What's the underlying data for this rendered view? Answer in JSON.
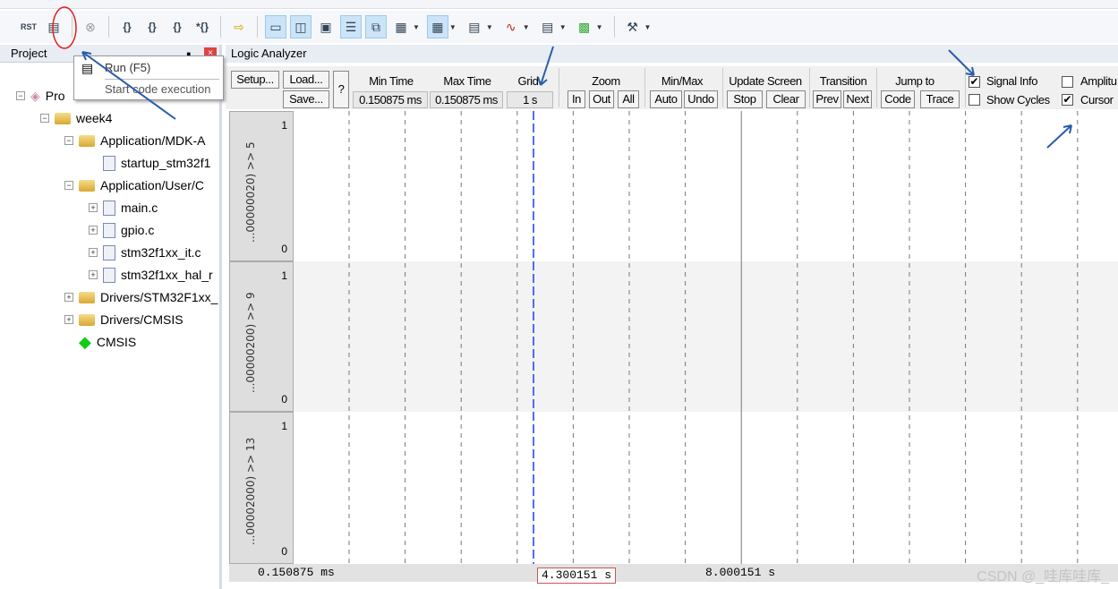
{
  "toolbar": {
    "icons": [
      "reset-icon",
      "run-icon",
      "stop-icon",
      "step-into-icon",
      "step-over-icon",
      "step-out-icon",
      "run-to-cursor-icon",
      "show-next-statement-icon",
      "command-window-icon",
      "disassembly-window-icon",
      "symbols-window-icon",
      "registers-window-icon",
      "call-stack-icon",
      "watch-windows-icon",
      "memory-windows-icon",
      "serial-windows-icon",
      "analysis-windows-icon",
      "trace-windows-icon",
      "system-viewer-icon",
      "toolbox-icon"
    ],
    "rst_label": "RST"
  },
  "project": {
    "title": "Project",
    "tree": [
      {
        "label": "Pro",
        "level": 0,
        "exp": "−",
        "icon": "project"
      },
      {
        "label": "week4",
        "level": 1,
        "exp": "−",
        "icon": "folder"
      },
      {
        "label": "Application/MDK-A",
        "level": 2,
        "exp": "−",
        "icon": "folder"
      },
      {
        "label": "startup_stm32f1",
        "level": 3,
        "exp": "",
        "icon": "file"
      },
      {
        "label": "Application/User/C",
        "level": 2,
        "exp": "−",
        "icon": "folder"
      },
      {
        "label": "main.c",
        "level": 3,
        "exp": "+",
        "icon": "file"
      },
      {
        "label": "gpio.c",
        "level": 3,
        "exp": "+",
        "icon": "file"
      },
      {
        "label": "stm32f1xx_it.c",
        "level": 3,
        "exp": "+",
        "icon": "file"
      },
      {
        "label": "stm32f1xx_hal_r",
        "level": 3,
        "exp": "+",
        "icon": "file"
      },
      {
        "label": "Drivers/STM32F1xx_",
        "level": 2,
        "exp": "+",
        "icon": "folder"
      },
      {
        "label": "Drivers/CMSIS",
        "level": 2,
        "exp": "+",
        "icon": "folder"
      },
      {
        "label": "CMSIS",
        "level": 2,
        "exp": "",
        "icon": "cmsis"
      }
    ]
  },
  "tooltip": {
    "title": "Run (F5)",
    "desc": "Start code execution"
  },
  "la": {
    "title": "Logic Analyzer",
    "setup": "Setup...",
    "load": "Load...",
    "save": "Save...",
    "help": "?",
    "min_time_label": "Min Time",
    "min_time": "0.150875 ms",
    "max_time_label": "Max Time",
    "max_time": "0.150875 ms",
    "grid_label": "Grid",
    "grid": "1 s",
    "zoom_label": "Zoom",
    "zoom_in": "In",
    "zoom_out": "Out",
    "zoom_all": "All",
    "minmax_label": "Min/Max",
    "auto": "Auto",
    "undo": "Undo",
    "update_label": "Update Screen",
    "stop": "Stop",
    "clear": "Clear",
    "transition_label": "Transition",
    "prev": "Prev",
    "next": "Next",
    "jump_label": "Jump to",
    "code": "Code",
    "trace": "Trace",
    "signal_info": "Signal Info",
    "signal_info_checked": true,
    "show_cycles": "Show Cycles",
    "show_cycles_checked": false,
    "amplitude": "Amplitu",
    "amplitude_checked": false,
    "cursor": "Cursor",
    "cursor_checked": true,
    "signals": [
      {
        "name": "...00000020) >> 5",
        "max": "1",
        "min": "0"
      },
      {
        "name": "...00000200) >> 9",
        "max": "1",
        "min": "0"
      },
      {
        "name": "...00002000) >> 13",
        "max": "1",
        "min": "0"
      }
    ],
    "axis": {
      "start": "0.150875 ms",
      "cursor": "4.300151 s",
      "mid": "8.000151 s"
    }
  },
  "watermark": "CSDN @_哇库哇库_",
  "colors": {
    "annotation": "#2a5caa",
    "highlight": "#e02020",
    "cursor": "#1a3cff"
  }
}
